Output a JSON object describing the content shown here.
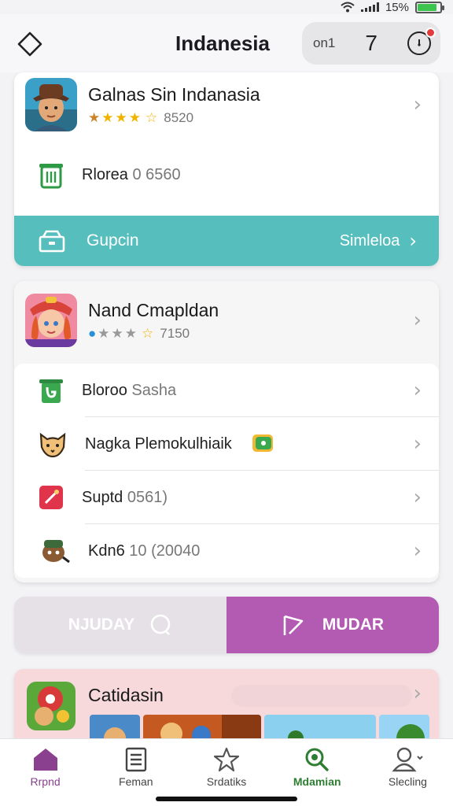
{
  "status_bar": {
    "battery_text": "15%"
  },
  "header": {
    "title": "Indanesia",
    "pill_label": "on1",
    "pill_number": "7"
  },
  "card1": {
    "title": "Galnas Sin Indanasia",
    "rating_value": "8520",
    "detail_label": "Rlorea",
    "detail_value": "0 6560",
    "action_label": "Gupcin",
    "action_right": "Simleloa"
  },
  "card2": {
    "title": "Nand Cmapldan",
    "rating_value": "7150",
    "items": [
      {
        "label": "Bloroo",
        "sub": "Sasha"
      },
      {
        "label": "Nagka Plemokulhiaik",
        "sub": ""
      },
      {
        "label": "Suptd",
        "sub": "0561)"
      },
      {
        "label": "Kdn6",
        "sub": "10 (20040"
      }
    ]
  },
  "segment": {
    "left_label": "NJUDAY",
    "right_label": "MUDAR"
  },
  "card4": {
    "title": "Catidasin"
  },
  "bottom_nav": [
    {
      "label": "Rrpnd",
      "icon": "home-icon"
    },
    {
      "label": "Feman",
      "icon": "list-icon"
    },
    {
      "label": "Srdatiks",
      "icon": "star-icon"
    },
    {
      "label": "Mdamian",
      "icon": "search-icon"
    },
    {
      "label": "Slecling",
      "icon": "person-icon"
    }
  ],
  "colors": {
    "teal": "#56bfbd",
    "purple": "#b35bb3",
    "active_nav": "#8a3f8f",
    "green": "#2e7d32",
    "star": "#f0b400"
  }
}
